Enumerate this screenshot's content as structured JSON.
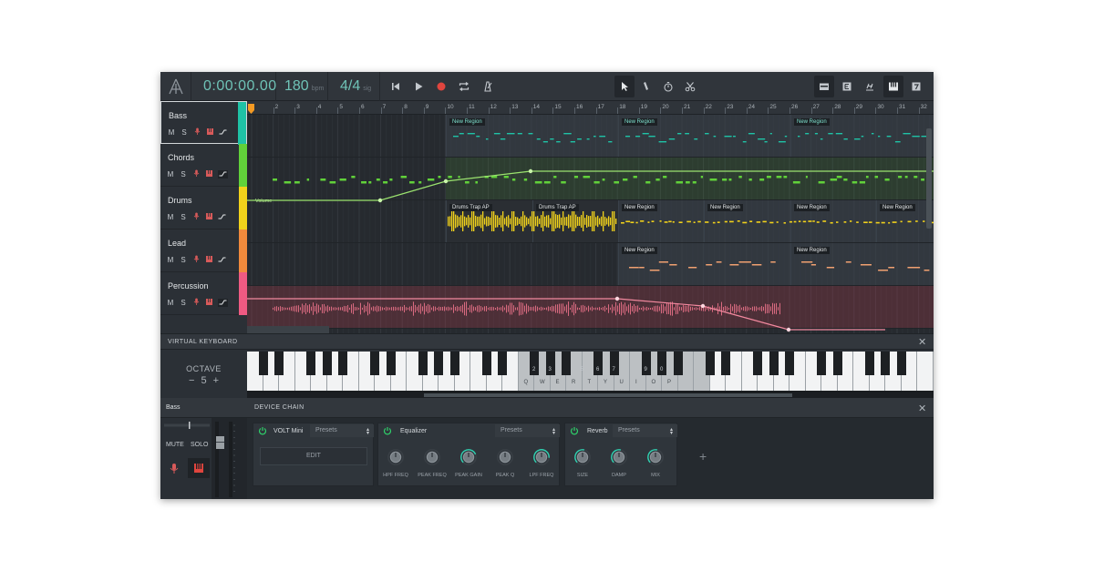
{
  "toolbar": {
    "logo": "A",
    "time": "0:00:00.00",
    "bpm": "180",
    "bpm_unit": "bpm",
    "signature": "4/4",
    "signature_unit": "sig"
  },
  "tracks": [
    {
      "name": "Bass",
      "mute": "M",
      "solo": "S",
      "color": "#1fc2a6"
    },
    {
      "name": "Chords",
      "mute": "M",
      "solo": "S",
      "color": "#61d13a"
    },
    {
      "name": "Drums",
      "mute": "M",
      "solo": "S",
      "color": "#f2d21b"
    },
    {
      "name": "Lead",
      "mute": "M",
      "solo": "S",
      "color": "#f08a3c"
    },
    {
      "name": "Percussion",
      "mute": "M",
      "solo": "S",
      "color": "#ef5a82"
    }
  ],
  "ruler": {
    "bars": [
      "2",
      "3",
      "4",
      "5",
      "6",
      "7",
      "8",
      "9",
      "10",
      "11",
      "12",
      "13",
      "14",
      "15",
      "16",
      "17",
      "18",
      "19",
      "20",
      "21",
      "22",
      "23",
      "24",
      "25",
      "26",
      "27",
      "28",
      "29",
      "30",
      "31",
      "32"
    ]
  },
  "regions": {
    "new_region": "New Region",
    "drums_a": "Drums Trap AP",
    "drums_b": "Drums Trap AP",
    "volume": "Volume"
  },
  "virtual_keyboard": {
    "title": "VIRTUAL KEYBOARD",
    "octave_label": "OCTAVE",
    "octave_minus": "−",
    "octave_value": "5",
    "octave_plus": "+",
    "key_letters": [
      "Q",
      "W",
      "E",
      "R",
      "T",
      "Y",
      "U",
      "I",
      "O",
      "P"
    ],
    "key_numbers": [
      "2",
      "3",
      "5",
      "6",
      "7",
      "9",
      "0"
    ]
  },
  "channel": {
    "name": "Bass",
    "mute_label": "MUTE",
    "solo_label": "SOLO"
  },
  "device_chain": {
    "title": "DEVICE CHAIN",
    "devices": [
      {
        "name": "VOLT Mini",
        "preset": "Presets",
        "edit": "EDIT"
      },
      {
        "name": "Equalizer",
        "preset": "Presets",
        "knobs": [
          "HPF FREQ",
          "PEAK FREQ",
          "PEAK GAIN",
          "PEAK Q",
          "LPF FREQ"
        ]
      },
      {
        "name": "Reverb",
        "preset": "Presets",
        "knobs": [
          "SIZE",
          "DAMP",
          "MIX"
        ]
      }
    ],
    "add": "+"
  },
  "colors": {
    "accent": "#6fc3b7",
    "record": "#e0453e",
    "playhead": "#f59a23"
  }
}
